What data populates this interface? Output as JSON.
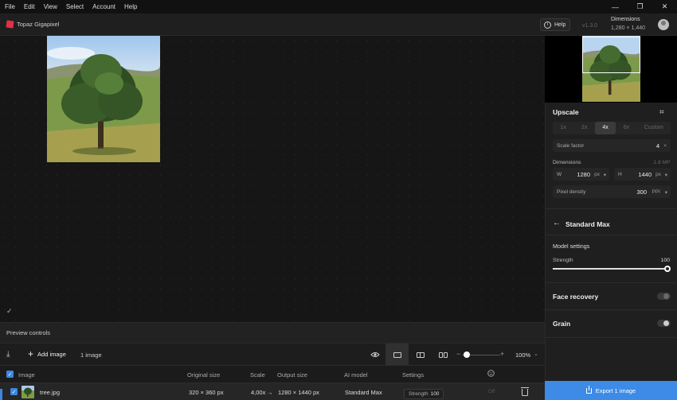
{
  "menu": [
    "File",
    "Edit",
    "View",
    "Select",
    "Account",
    "Help"
  ],
  "window_controls": {
    "minimize": "—",
    "restore": "❐",
    "close": "✕"
  },
  "header": {
    "app_name": "Topaz Gigapixel",
    "help_label": "Help",
    "version": "v1.3.0",
    "dimensions_title": "Dimensions",
    "dimensions_value": "1,280 × 1,440"
  },
  "canvas": {
    "check_glyph": "✓"
  },
  "preview_controls": {
    "label": "Preview controls"
  },
  "toolbar": {
    "add_image_label": "Add image",
    "image_count": "1 image",
    "zoom_value": "100%",
    "zoom_minus": "−",
    "zoom_plus": "+",
    "zoom_level": 0.1
  },
  "table": {
    "headers": {
      "image": "Image",
      "original_size": "Original size",
      "scale": "Scale",
      "output_size": "Output size",
      "ai_model": "AI model",
      "settings": "Settings"
    },
    "rows": [
      {
        "file": "tree.jpg",
        "original_size": "320 × 360 px",
        "scale": "4,00x",
        "arrow": "→",
        "output_size": "1280 × 1440 px",
        "ai_model": "Standard Max",
        "strength_label": "Strength",
        "strength_value": "100",
        "off": "Off"
      }
    ]
  },
  "panel": {
    "upscale_title": "Upscale",
    "scale_options": [
      "1x",
      "2x",
      "4x",
      "6x",
      "Custom"
    ],
    "selected_scale": "4x",
    "scale_factor_label": "Scale factor",
    "scale_factor_value": "4",
    "scale_factor_unit": "×",
    "dimensions_label": "Dimensions",
    "megapixels": "1.8 MP",
    "width_label": "W",
    "width_value": "1280",
    "height_label": "H",
    "height_value": "1440",
    "unit": "px",
    "pixel_density_label": "Pixel density",
    "pixel_density_value": "300",
    "pixel_density_unit": "PPI",
    "model_name": "Standard Max",
    "model_settings_label": "Model settings",
    "strength_label": "Strength",
    "strength_value": "100",
    "face_recovery_label": "Face recovery",
    "face_recovery_on": false,
    "grain_label": "Grain",
    "grain_on": false
  },
  "export": {
    "label": "Export 1 image"
  },
  "colors": {
    "accent": "#3d8be6",
    "brand": "#e0304a",
    "background": "#1b1b1b"
  }
}
